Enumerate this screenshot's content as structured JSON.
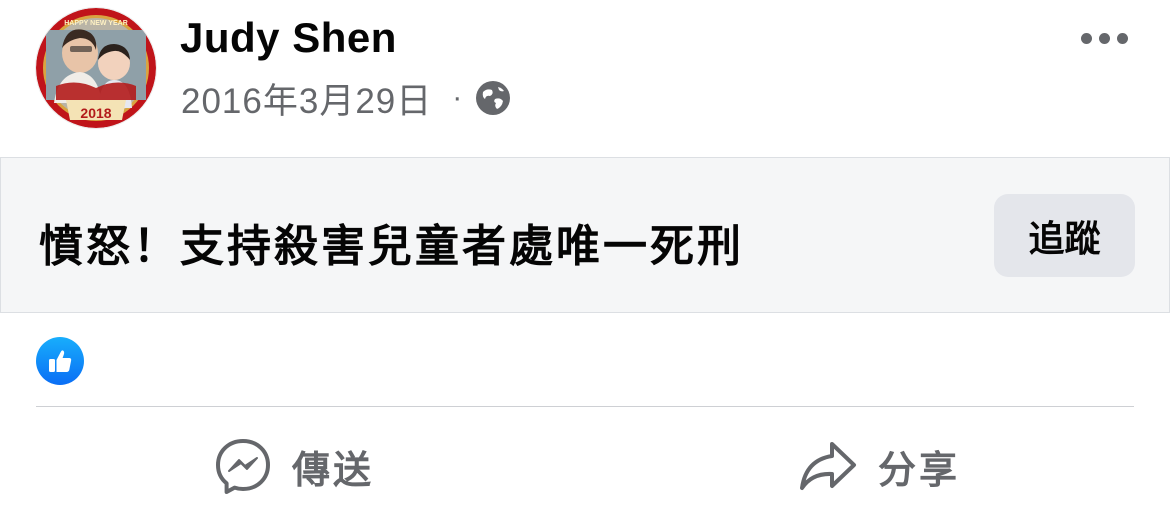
{
  "post": {
    "author": "Judy Shen",
    "date": "2016年3月29日",
    "separator": "·",
    "privacy_icon": "globe-icon",
    "avatar_badge_text": "2018",
    "avatar_banner_text": "HAPPY NEW YEAR"
  },
  "group": {
    "title": "憤怒！支持殺害兒童者處唯一死刑",
    "follow_label": "追蹤"
  },
  "reactions": {
    "icon": "like-icon"
  },
  "actions": {
    "send_label": "傳送",
    "share_label": "分享"
  },
  "colors": {
    "like_blue": "#1877f2",
    "secondary_text": "#65676b",
    "card_bg": "#f5f6f7",
    "button_bg": "#e4e6eb"
  }
}
